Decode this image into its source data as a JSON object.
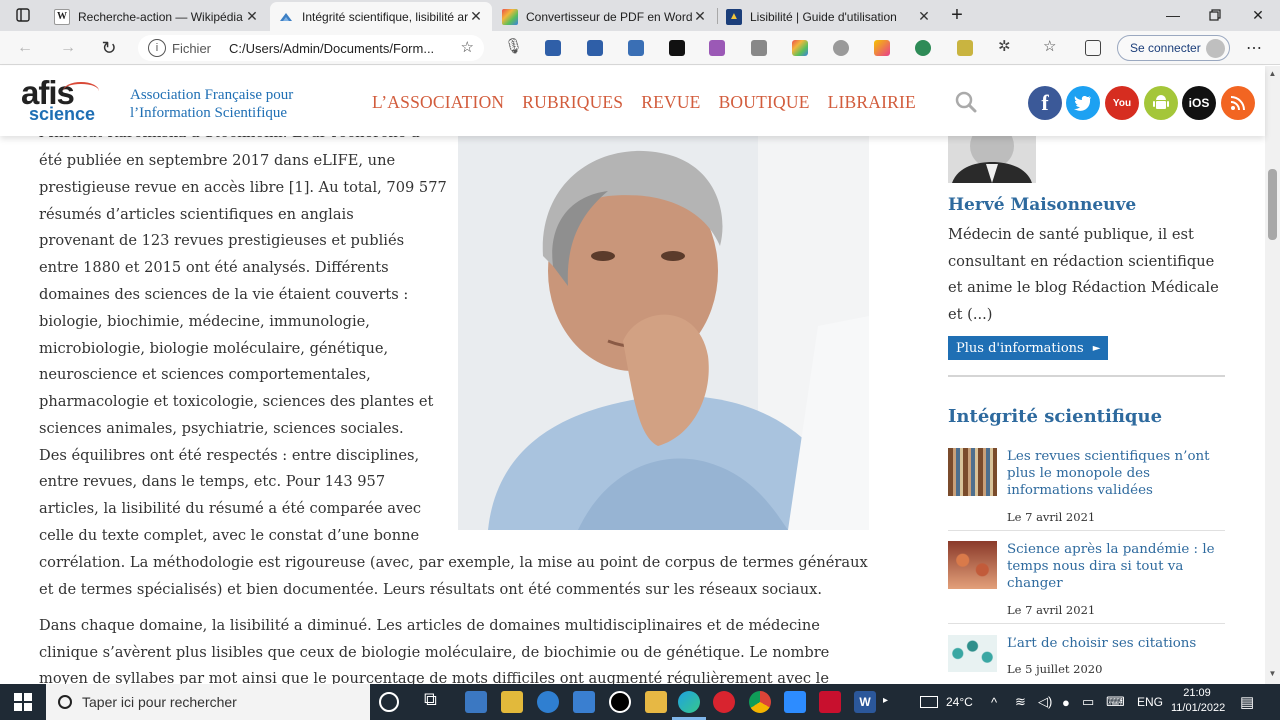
{
  "browser": {
    "tabs": [
      {
        "title": "Recherche-action — Wikipédia",
        "favicon": "W",
        "active": false
      },
      {
        "title": "Intégrité scientifique, lisibilité art",
        "favicon": "",
        "active": true
      },
      {
        "title": "Convertisseur de PDF en Word -",
        "favicon": "",
        "active": false
      },
      {
        "title": "Lisibilité | Guide d'utilisation",
        "favicon": "",
        "active": false
      }
    ],
    "new_tab_label": "+",
    "address": {
      "protocol_label": "Fichier",
      "url": "C:/Users/Admin/Documents/Form..."
    },
    "signin_label": "Se connecter"
  },
  "site": {
    "logo_top": "afis",
    "logo_bottom": "science",
    "association_line1": "Association Française pour",
    "association_line2": "l’Information Scientifique",
    "nav": [
      "L’ASSOCIATION",
      "RUBRIQUES",
      "REVUE",
      "BOUTIQUE",
      "LIBRAIRIE"
    ],
    "social": [
      {
        "name": "facebook",
        "label": "f",
        "color": "#3b5998"
      },
      {
        "name": "twitter",
        "label": "t",
        "color": "#1da1f2"
      },
      {
        "name": "youtube",
        "label": "You",
        "color": "#d62d20"
      },
      {
        "name": "android",
        "label": "A",
        "color": "#a4c639"
      },
      {
        "name": "ios",
        "label": "iOS",
        "color": "#111111"
      },
      {
        "name": "rss",
        "label": "))",
        "color": "#f26522"
      }
    ]
  },
  "article": {
    "lines": [
      "l’Institut Karolinska à Stockholm. Leur recherche a",
      "été publiée en septembre 2017 dans eLIFE, une",
      "prestigieuse revue en accès libre [1]. Au total, 709 577",
      "résumés d’articles scientifiques en anglais",
      "provenant de 123 revues prestigieuses et publiés",
      "entre 1880 et 2015 ont été analysés. Différents",
      "domaines des sciences de la vie étaient couverts :",
      "biologie, biochimie, médecine, immunologie,",
      "microbiologie, biologie moléculaire, génétique,",
      "neuroscience et sciences comportementales,",
      "pharmacologie et toxicologie, sciences des plantes et",
      "sciences animales, psychiatrie, sciences sociales.",
      "Des équilibres ont été respectés : entre disciplines,",
      "entre revues, dans le temps, etc. Pour 143 957",
      "articles, la lisibilité du résumé a été comparée avec",
      "celle du texte complet, avec le constat d’une bonne",
      "corrélation. La méthodologie est rigoureuse (avec, par exemple, la mise au point de corpus de termes généraux",
      "et de termes spécialisés) et bien documentée. Leurs résultats ont été commentés sur les réseaux sociaux."
    ],
    "para2_lines": [
      "Dans chaque domaine, la lisibilité a diminué. Les articles de domaines multidisciplinaires et de médecine",
      "clinique s’avèrent plus lisibles que ceux de biologie moléculaire, de biochimie ou de génétique. Le nombre",
      "moyen de syllabes par mot ainsi que le pourcentage de mots difficiles ont augmenté régulièrement avec le"
    ]
  },
  "sidebar": {
    "author_name": "Hervé Maisonneuve",
    "author_bio": "Médecin de santé publique, il est consultant en rédaction scientifique et anime le blog Rédaction Médicale et (...)",
    "more_button": "Plus d'informations",
    "section_title": "Intégrité scientifique",
    "items": [
      {
        "title": "Les revues scientifiques n’ont plus le monopole des informations validées",
        "date": "Le 7 avril 2021"
      },
      {
        "title": "Science après la pandémie : le temps nous dira si tout va changer",
        "date": "Le 7 avril 2021"
      },
      {
        "title": "L’art de choisir ses citations",
        "date": "Le 5 juillet 2020"
      }
    ]
  },
  "taskbar": {
    "search_placeholder": "Taper ici pour rechercher",
    "weather": "24°C",
    "language": "ENG",
    "time": "21:09",
    "date": "11/01/2022"
  },
  "colors": {
    "site_blue": "#2e6a9e",
    "nav_red": "#d25c3c",
    "taskbar": "#1f2a35"
  }
}
